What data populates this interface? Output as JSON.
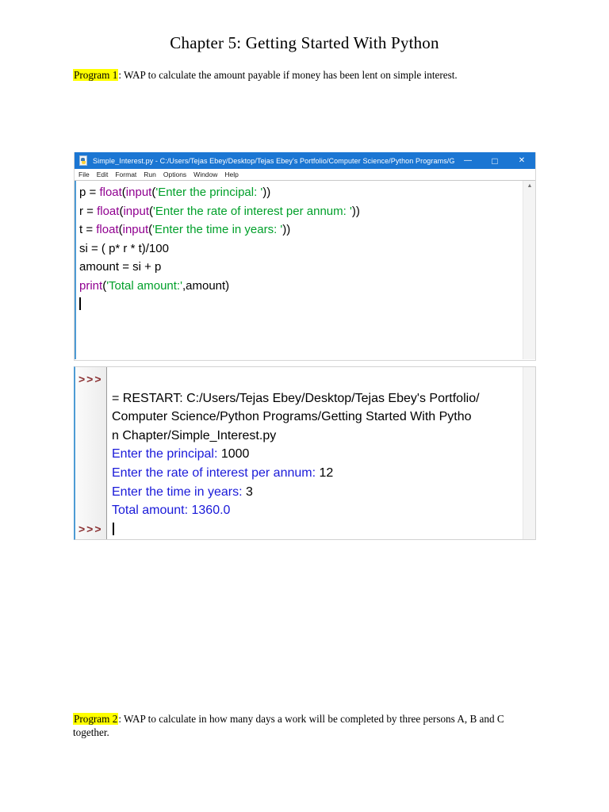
{
  "page": {
    "title": "Chapter 5: Getting Started With Python"
  },
  "program1": {
    "label": "Program 1",
    "text": ": WAP to calculate the amount payable if money has been lent on simple interest."
  },
  "program2": {
    "label": "Program 2",
    "text": ": WAP to calculate in how many days a work will be completed by three persons A, B and C together."
  },
  "colors": {
    "titlebar": "#1b76d3",
    "builtin": "#900090",
    "string": "#00a02a",
    "stdout": "#1a1ad9",
    "prompt": "#8a3032",
    "highlight": "#ffff00"
  },
  "editor": {
    "icon": "python-file-icon",
    "title": "Simple_Interest.py - C:/Users/Tejas Ebey/Desktop/Tejas Ebey's Portfolio/Computer Science/Python Programs/G...",
    "controls": {
      "minimize": "—",
      "maximize": "□",
      "close": "✕"
    },
    "menus": [
      "File",
      "Edit",
      "Format",
      "Run",
      "Options",
      "Window",
      "Help"
    ],
    "scroll_up_glyph": "▲",
    "code": [
      [
        [
          "n",
          "p = "
        ],
        [
          "b",
          "float"
        ],
        [
          "n",
          "("
        ],
        [
          "b",
          "input"
        ],
        [
          "n",
          "("
        ],
        [
          "s",
          "'Enter the principal: '"
        ],
        [
          "n",
          "))"
        ]
      ],
      [
        [
          "n",
          "r = "
        ],
        [
          "b",
          "float"
        ],
        [
          "n",
          "("
        ],
        [
          "b",
          "input"
        ],
        [
          "n",
          "("
        ],
        [
          "s",
          "'Enter the rate of interest per annum: '"
        ],
        [
          "n",
          "))"
        ]
      ],
      [
        [
          "n",
          "t = "
        ],
        [
          "b",
          "float"
        ],
        [
          "n",
          "("
        ],
        [
          "b",
          "input"
        ],
        [
          "n",
          "("
        ],
        [
          "s",
          "'Enter the time in years: '"
        ],
        [
          "n",
          "))"
        ]
      ],
      [
        [
          "n",
          "si = ( p* r * t)/100"
        ]
      ],
      [
        [
          "n",
          "amount = si + p"
        ]
      ],
      [
        [
          "b",
          "print"
        ],
        [
          "n",
          "("
        ],
        [
          "s",
          "'Total amount:'"
        ],
        [
          "n",
          ",amount)"
        ]
      ]
    ]
  },
  "shell": {
    "prompt": ">>>",
    "prompt_rows": [
      0,
      8
    ],
    "row_count": 9,
    "lines": [
      [],
      [
        [
          "n",
          "= RESTART: C:/Users/Tejas Ebey/Desktop/Tejas Ebey's Portfolio/"
        ]
      ],
      [
        [
          "n",
          "Computer Science/Python Programs/Getting Started With Pytho"
        ]
      ],
      [
        [
          "n",
          "n Chapter/Simple_Interest.py"
        ]
      ],
      [
        [
          "o",
          "Enter the principal: "
        ],
        [
          "n",
          "1000"
        ]
      ],
      [
        [
          "o",
          "Enter the rate of interest per annum: "
        ],
        [
          "n",
          "12"
        ]
      ],
      [
        [
          "o",
          "Enter the time in years: "
        ],
        [
          "n",
          "3"
        ]
      ],
      [
        [
          "o",
          "Total amount: 1360.0"
        ]
      ]
    ]
  }
}
